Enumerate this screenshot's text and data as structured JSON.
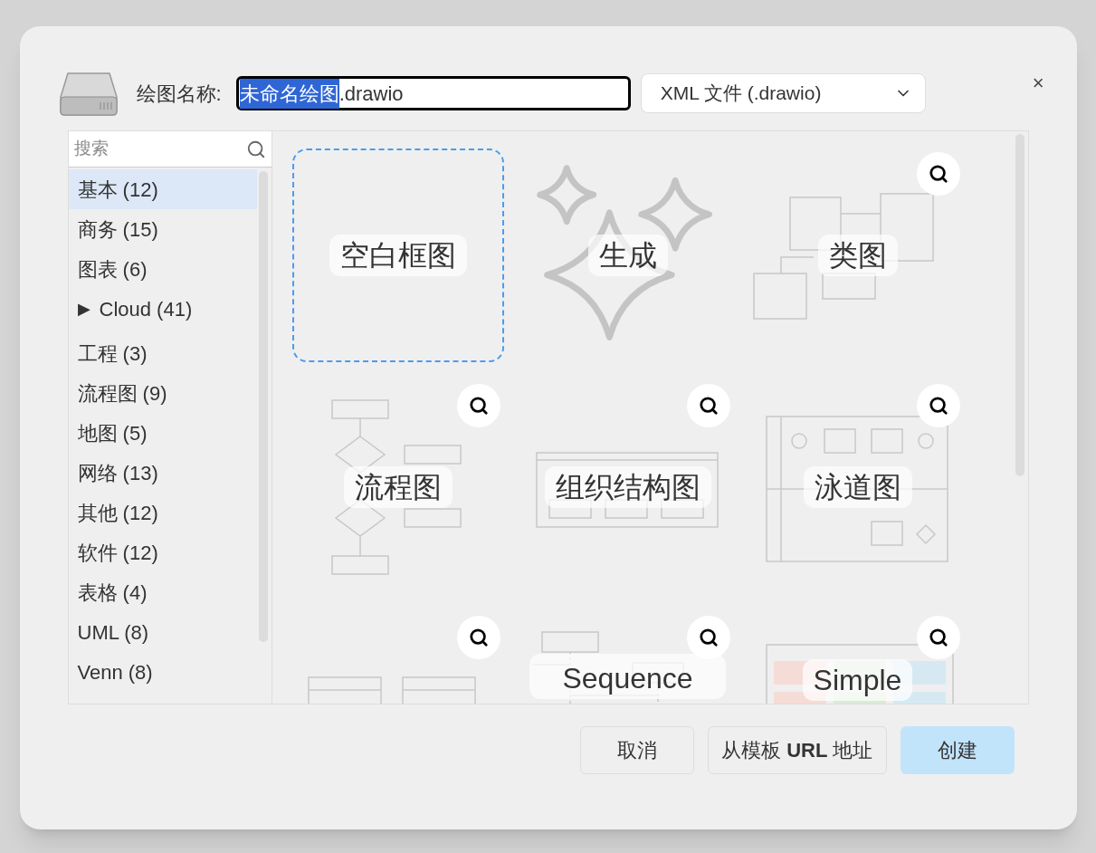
{
  "dialog": {
    "close": "×",
    "filename": {
      "label": "绘图名称:",
      "text_selected": "未命名绘图",
      "text_rest": ".drawio"
    },
    "format": {
      "value": "XML 文件 (.drawio)"
    },
    "search": {
      "placeholder": "搜索"
    },
    "categories": [
      {
        "label": "基本 (12)",
        "selected": true,
        "kind": "item"
      },
      {
        "label": "商务 (15)",
        "selected": false,
        "kind": "item"
      },
      {
        "label": "图表 (6)",
        "selected": false,
        "kind": "item"
      },
      {
        "label": "Cloud (41)",
        "selected": false,
        "kind": "group",
        "expanded": false,
        "toggle": "▶"
      },
      {
        "label": "工程 (3)",
        "selected": false,
        "kind": "item"
      },
      {
        "label": "流程图 (9)",
        "selected": false,
        "kind": "item"
      },
      {
        "label": "地图 (5)",
        "selected": false,
        "kind": "item"
      },
      {
        "label": "网络 (13)",
        "selected": false,
        "kind": "item"
      },
      {
        "label": "其他 (12)",
        "selected": false,
        "kind": "item"
      },
      {
        "label": "软件 (12)",
        "selected": false,
        "kind": "item"
      },
      {
        "label": "表格 (4)",
        "selected": false,
        "kind": "item"
      },
      {
        "label": "UML (8)",
        "selected": false,
        "kind": "item"
      },
      {
        "label": "Venn (8)",
        "selected": false,
        "kind": "item"
      }
    ],
    "templates": [
      {
        "kind": "blank",
        "label": "空白框图",
        "selected": true,
        "preview": false
      },
      {
        "kind": "generate",
        "label": "生成",
        "selected": false,
        "preview": false
      },
      {
        "kind": "class",
        "label": "类图",
        "selected": false,
        "preview": true
      },
      {
        "kind": "flow",
        "label": "流程图",
        "selected": false,
        "preview": true
      },
      {
        "kind": "org",
        "label": "组织结构图",
        "selected": false,
        "preview": true
      },
      {
        "kind": "swimlane",
        "label": "泳道图",
        "selected": false,
        "preview": true
      },
      {
        "kind": "er",
        "selected": false,
        "preview": true
      },
      {
        "kind": "sequence",
        "label": "Sequence",
        "selected": false,
        "preview": true
      },
      {
        "kind": "simple",
        "label": "Simple",
        "selected": false,
        "preview": true
      }
    ],
    "buttons": [
      {
        "kind": "secondary",
        "label": "取消"
      },
      {
        "kind": "secondary",
        "label": "从模板 **URL** 地址"
      },
      {
        "kind": "primary",
        "label": "创建"
      }
    ]
  }
}
